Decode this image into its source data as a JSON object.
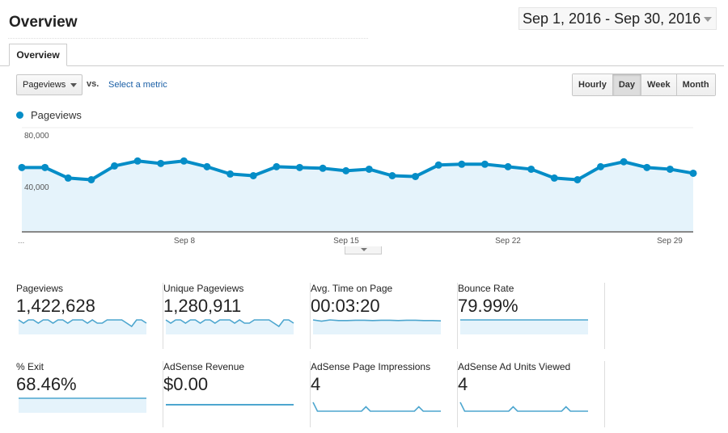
{
  "header": {
    "title": "Overview",
    "date_range": "Sep 1, 2016 - Sep 30, 2016",
    "tab": "Overview"
  },
  "controls": {
    "metric": "Pageviews",
    "vs": "vs.",
    "select_metric": "Select a metric",
    "granularity": [
      "Hourly",
      "Day",
      "Week",
      "Month"
    ],
    "active": "Day"
  },
  "colors": {
    "line": "#058dc7",
    "fill": "#e5f3fb"
  },
  "chart_data": {
    "type": "area",
    "series": [
      {
        "name": "Pageviews",
        "values": [
          49400,
          49400,
          41300,
          40000,
          50600,
          54400,
          52500,
          54400,
          50000,
          44400,
          43100,
          50000,
          49400,
          48800,
          46900,
          48100,
          43100,
          42500,
          51300,
          51900,
          51900,
          50000,
          48100,
          41300,
          40000,
          50000,
          53800,
          49400,
          48100,
          45000
        ]
      }
    ],
    "x": [
      "Sep 1",
      "Sep 2",
      "Sep 3",
      "Sep 4",
      "Sep 5",
      "Sep 6",
      "Sep 7",
      "Sep 8",
      "Sep 9",
      "Sep 10",
      "Sep 11",
      "Sep 12",
      "Sep 13",
      "Sep 14",
      "Sep 15",
      "Sep 16",
      "Sep 17",
      "Sep 18",
      "Sep 19",
      "Sep 20",
      "Sep 21",
      "Sep 22",
      "Sep 23",
      "Sep 24",
      "Sep 25",
      "Sep 26",
      "Sep 27",
      "Sep 28",
      "Sep 29",
      "Sep 30"
    ],
    "x_tick_labels": [
      "...",
      "Sep 8",
      "Sep 15",
      "Sep 22",
      "Sep 29"
    ],
    "y_ticks": [
      "40,000",
      "80,000"
    ],
    "ylim": [
      0,
      80000
    ],
    "grid": true,
    "legend": "top-left"
  },
  "metrics": [
    {
      "label": "Pageviews",
      "value": "1,422,628",
      "spark": [
        5,
        4,
        5,
        5,
        4,
        5,
        5,
        4,
        5,
        5,
        4,
        5,
        5,
        5,
        4,
        5,
        4,
        4,
        5,
        5,
        5,
        5,
        4,
        3,
        5,
        5,
        4
      ]
    },
    {
      "label": "Unique Pageviews",
      "value": "1,280,911",
      "spark": [
        5,
        4,
        5,
        5,
        4,
        5,
        5,
        4,
        5,
        5,
        4,
        5,
        5,
        5,
        4,
        5,
        4,
        4,
        5,
        5,
        5,
        5,
        4,
        3,
        5,
        5,
        4
      ]
    },
    {
      "label": "Avg. Time on Page",
      "value": "00:03:20",
      "spark": [
        5,
        4.6,
        5,
        4.8,
        4.8,
        4.9,
        4.9,
        4.8,
        4.9,
        4.9,
        4.8,
        4.9,
        4.9,
        4.8,
        4.8,
        4.7
      ]
    },
    {
      "label": "Bounce Rate",
      "value": "79.99%",
      "spark": [
        5,
        5,
        5,
        5,
        5,
        5,
        5,
        5
      ]
    },
    {
      "label": "% Exit",
      "value": "68.46%",
      "spark": [
        5,
        5,
        5,
        5,
        5,
        5,
        5,
        5
      ]
    },
    {
      "label": "AdSense Revenue",
      "value": "$0.00",
      "spark": [
        0,
        0,
        0,
        0
      ]
    },
    {
      "label": "AdSense Page Impressions",
      "value": "4",
      "spark": [
        2,
        0,
        0,
        0,
        0,
        0,
        0,
        0,
        0,
        0,
        0,
        0,
        1,
        0,
        0,
        0,
        0,
        0,
        0,
        0,
        0,
        0,
        0,
        0,
        1,
        0,
        0,
        0,
        0,
        0
      ]
    },
    {
      "label": "AdSense Ad Units Viewed",
      "value": "4",
      "spark": [
        2,
        0,
        0,
        0,
        0,
        0,
        0,
        0,
        0,
        0,
        0,
        0,
        1,
        0,
        0,
        0,
        0,
        0,
        0,
        0,
        0,
        0,
        0,
        0,
        1,
        0,
        0,
        0,
        0,
        0
      ]
    }
  ]
}
